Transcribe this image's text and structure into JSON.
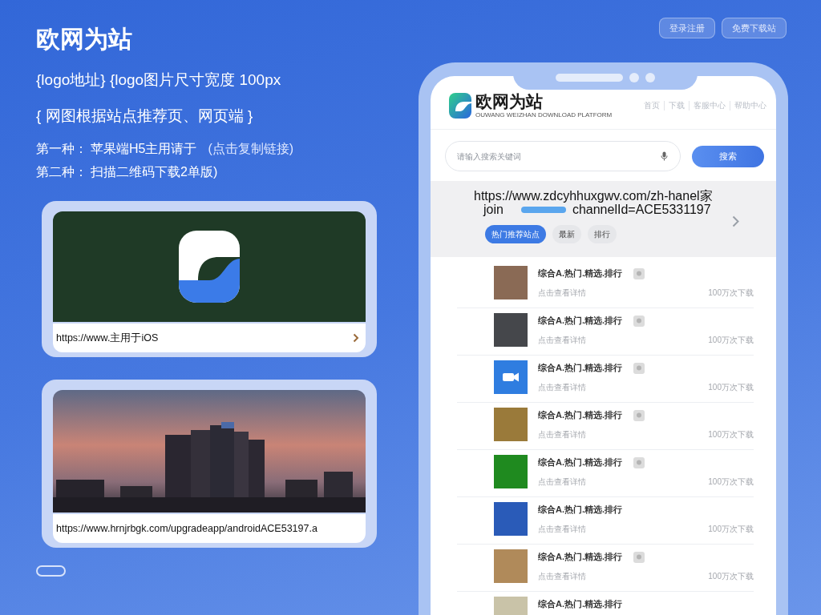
{
  "header": {
    "title": "欧网为站",
    "buttons": [
      {
        "label": "登录注册"
      },
      {
        "label": "免费下载站"
      }
    ]
  },
  "intro": {
    "logo_line": "{logo地址} {logo图片尺寸宽度 100px",
    "note_line": "{ 网图根据站点推荐页、网页端 }",
    "methods": [
      {
        "label": "第一种：",
        "text": "苹果端H5主用请于",
        "link": "(点击复制链接)"
      },
      {
        "label": "第二种：",
        "text": "扫描二维码下载2单版)"
      }
    ]
  },
  "cards": [
    {
      "kind": "logo",
      "url": "https://www.主用于iOS",
      "chevron": true
    },
    {
      "kind": "skyline",
      "url": "https://www.hrnjrbgk.com/upgradeapp/androidACE53197.a",
      "chevron": false
    }
  ],
  "phone": {
    "brand": {
      "name": "欧网为站",
      "tagline": "OUWANG WEIZHAN DOWNLOAD PLATFORM"
    },
    "nav": [
      "首页",
      "下载",
      "客服中心",
      "帮助中心"
    ],
    "search": {
      "placeholder": "请输入搜索关键词",
      "button": "搜索"
    },
    "banner": {
      "url_line": "https://www.zdcyhhuxgwv.com/zh-hanel家",
      "url_prefix": "join",
      "url_suffix": "channelId=ACE5331197"
    },
    "chips": [
      {
        "label": "热门推荐站点",
        "selected": true
      },
      {
        "label": "最新",
        "selected": false
      },
      {
        "label": "排行",
        "selected": false
      }
    ],
    "items": [
      {
        "kind": "photo",
        "color": "#8a6a55",
        "title": "综合A.热门.精选.排行",
        "subtitle": "点击查看详情",
        "meta": "100万次下载",
        "badge": true
      },
      {
        "kind": "photo",
        "color": "#45474b",
        "title": "综合A.热门.精选.排行",
        "subtitle": "点击查看详情",
        "meta": "100万次下载",
        "badge": true
      },
      {
        "kind": "camera",
        "color": "#2f7de0",
        "title": "综合A.热门.精选.排行",
        "subtitle": "点击查看详情",
        "meta": "100万次下载",
        "badge": true
      },
      {
        "kind": "photo",
        "color": "#9a7a3a",
        "title": "综合A.热门.精选.排行",
        "subtitle": "点击查看详情",
        "meta": "100万次下载",
        "badge": true
      },
      {
        "kind": "photo",
        "color": "#1f8a1f",
        "title": "综合A.热门.精选.排行",
        "subtitle": "点击查看详情",
        "meta": "100万次下载",
        "badge": true
      },
      {
        "kind": "photo",
        "color": "#2a5bb8",
        "title": "综合A.热门.精选.排行",
        "subtitle": "点击查看详情",
        "meta": "100万次下载",
        "badge": false
      },
      {
        "kind": "photo",
        "color": "#b08a5a",
        "title": "综合A.热门.精选.排行",
        "subtitle": "点击查看详情",
        "meta": "100万次下载",
        "badge": true
      },
      {
        "kind": "photo",
        "color": "#c9c3a8",
        "title": "综合A.热门.精选.排行",
        "badge": false
      }
    ]
  }
}
